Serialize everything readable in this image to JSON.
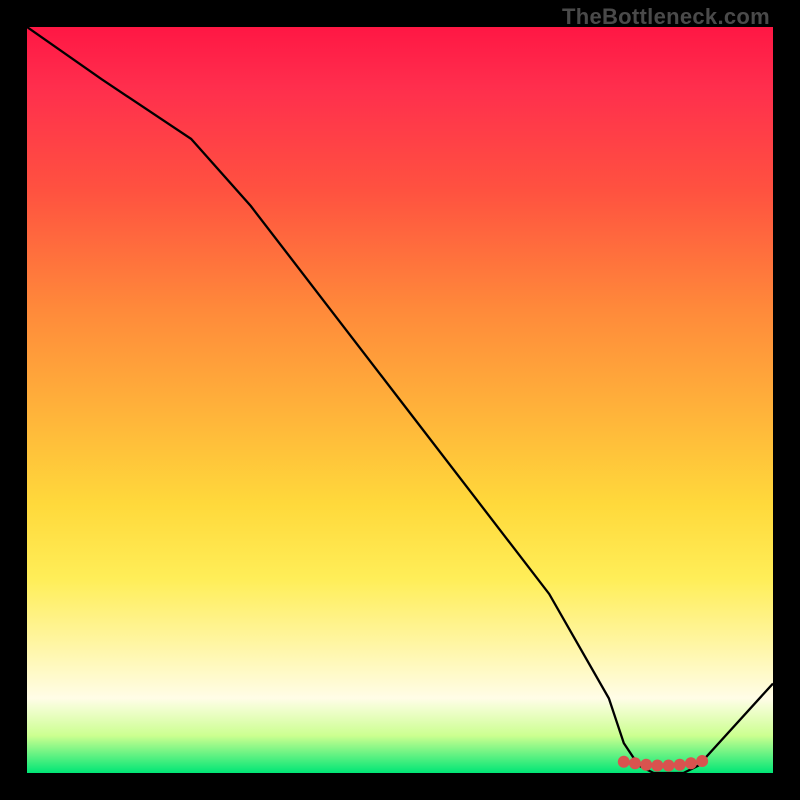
{
  "watermark": {
    "text": "TheBottleneck.com"
  },
  "chart_data": {
    "type": "line",
    "title": "",
    "xlabel": "",
    "ylabel": "",
    "xlim": [
      0,
      100
    ],
    "ylim": [
      0,
      100
    ],
    "grid": false,
    "legend": false,
    "x": [
      0,
      10,
      22,
      30,
      40,
      50,
      60,
      70,
      78,
      80,
      82,
      84,
      86,
      88,
      90,
      100
    ],
    "values": [
      100,
      93,
      85,
      76,
      63,
      50,
      37,
      24,
      10,
      4,
      1,
      0,
      0,
      0,
      1,
      12
    ],
    "markers": {
      "x": [
        80,
        81.5,
        83,
        84.5,
        86,
        87.5,
        89,
        90.5
      ],
      "y": [
        1.5,
        1.3,
        1.1,
        1.0,
        1.0,
        1.1,
        1.3,
        1.6
      ],
      "color": "#d9534f",
      "radius": 6
    },
    "line_color": "#000000",
    "line_width": 2.3
  }
}
